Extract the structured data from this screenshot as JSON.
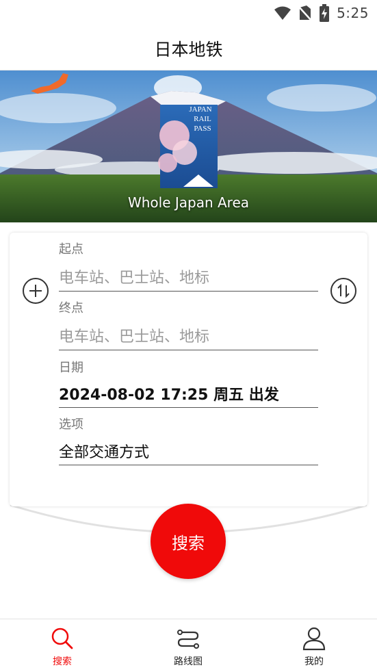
{
  "status_bar": {
    "time": "5:25",
    "icons": [
      "wifi-icon",
      "no-sim-icon",
      "battery-charging-icon"
    ]
  },
  "header": {
    "title": "日本地铁"
  },
  "banner": {
    "caption": "Whole Japan Area",
    "pass_text": [
      "JAPAN",
      "RAIL",
      "PASS"
    ]
  },
  "form": {
    "origin": {
      "label": "起点",
      "placeholder": "电车站、巴士站、地标"
    },
    "destination": {
      "label": "终点",
      "placeholder": "电车站、巴士站、地标"
    },
    "date": {
      "label": "日期",
      "value": "2024-08-02 17:25 周五 出发"
    },
    "options": {
      "label": "选项",
      "value": "全部交通方式"
    },
    "add_icon": "plus-circle-icon",
    "swap_icon": "swap-arrows-icon"
  },
  "search_button": {
    "label": "搜索"
  },
  "bottom_nav": {
    "items": [
      {
        "label": "搜索",
        "icon": "search-icon",
        "active": true
      },
      {
        "label": "路线图",
        "icon": "route-map-icon",
        "active": false
      },
      {
        "label": "我的",
        "icon": "user-icon",
        "active": false
      }
    ]
  },
  "colors": {
    "accent": "#f00a0a",
    "text": "#111111",
    "muted": "#777777",
    "placeholder": "#9a9a9a"
  }
}
